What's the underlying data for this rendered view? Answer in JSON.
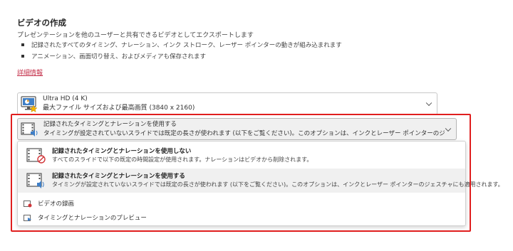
{
  "section": {
    "title": "ビデオの作成",
    "description": "プレゼンテーションを他のユーザーと共有できるビデオとしてエクスポートします",
    "bullets": [
      "記録されたすべてのタイミング、ナレーション、インク ストローク、レーザー ポインターの動きが組み込まれます",
      "アニメーション、画面切り替え、およびメディアも保存されます"
    ],
    "more_info_link": "詳細情報"
  },
  "quality_select": {
    "icon": "monitor-star-icon",
    "line1": "Ultra HD (4 K)",
    "line2": "最大ファイル サイズおよび最高画質 (3840 x 2160)"
  },
  "timing_select": {
    "icon": "film-speaker-icon",
    "line1": "記録されたタイミングとナレーションを使用する",
    "line2": "タイミングが設定されていないスライドでは既定の長さが使われます (以下をご覧ください)。このオプションは、インクとレーザー ポインターのジェスチャにも適..."
  },
  "dropdown": {
    "options": [
      {
        "icon": "film-no-sound-icon",
        "title": "記録されたタイミングとナレーションを使用しない",
        "subtitle": "すべてのスライドで以下の既定の時間設定が使用されます。ナレーションはビデオから削除されます。"
      },
      {
        "icon": "film-speaker-icon",
        "title": "記録されたタイミングとナレーションを使用する",
        "subtitle": "タイミングが設定されていないスライドでは既定の長さが使われます (以下をご覧ください)。このオプションは、インクとレーザー ポインターのジェスチャにも適用されます。"
      }
    ],
    "actions": [
      {
        "icon": "record-video-icon",
        "label": "ビデオの録画"
      },
      {
        "icon": "preview-timing-icon",
        "label": "タイミングとナレーションのプレビュー"
      }
    ]
  },
  "colors": {
    "highlight_frame": "#e01e1e",
    "link": "#c4314b",
    "selected_option_bg": "#f0f0f0"
  }
}
